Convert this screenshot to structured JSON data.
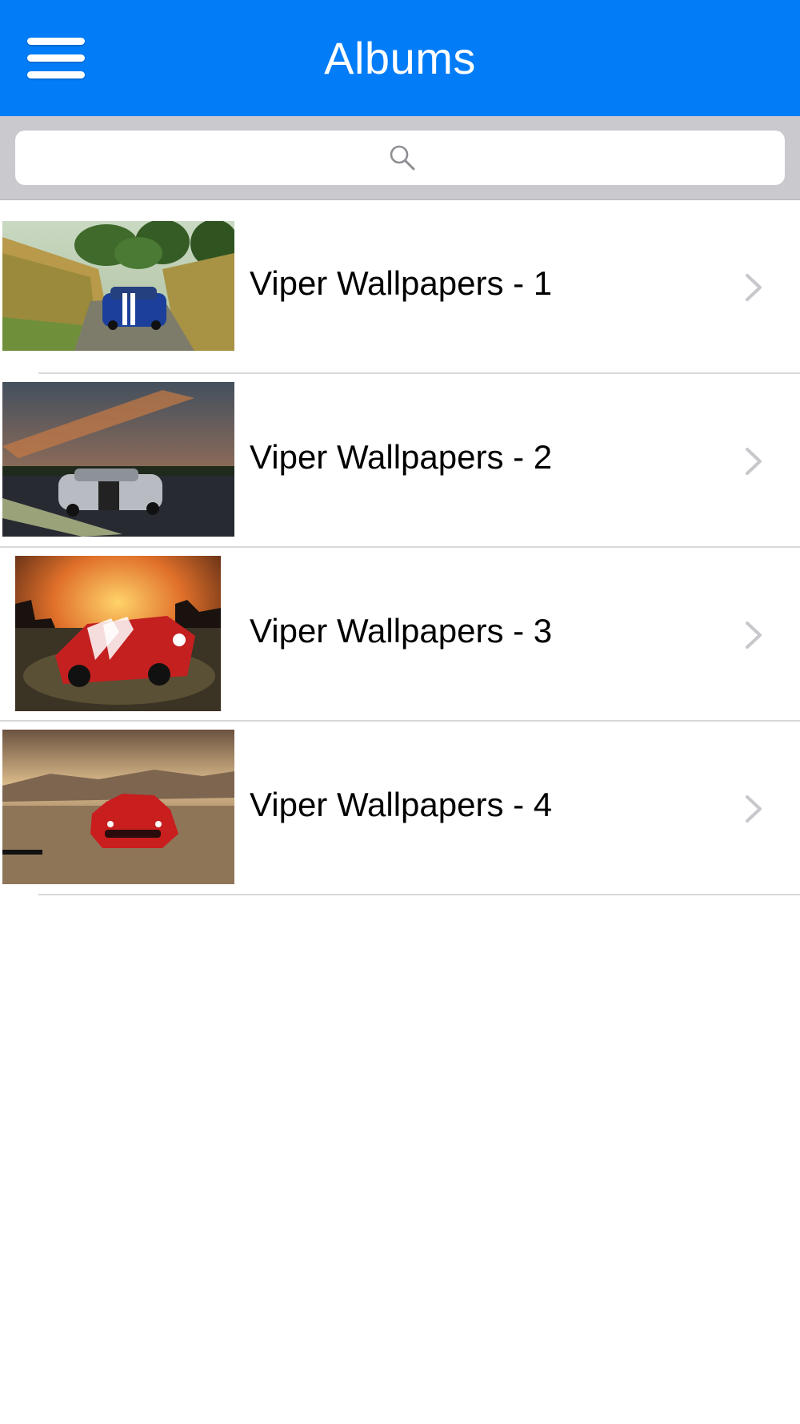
{
  "header": {
    "title": "Albums",
    "background": "#037cf8",
    "menu_icon": "hamburger-menu-icon"
  },
  "search": {
    "placeholder": "",
    "icon": "search-icon",
    "background": "#c9c9ce"
  },
  "albums": [
    {
      "label": "Viper Wallpapers - 1",
      "thumb": "blue Viper on a country road between corn fields"
    },
    {
      "label": "Viper Wallpapers - 2",
      "thumb": "silver Viper with black stripes on a track at dusk"
    },
    {
      "label": "Viper Wallpapers - 3",
      "thumb": "red Viper race car with white stripes under a fiery sky"
    },
    {
      "label": "Viper Wallpapers - 4",
      "thumb": "red Viper in a desert with mountains"
    }
  ],
  "row_accessory_icon": "chevron-right-icon"
}
